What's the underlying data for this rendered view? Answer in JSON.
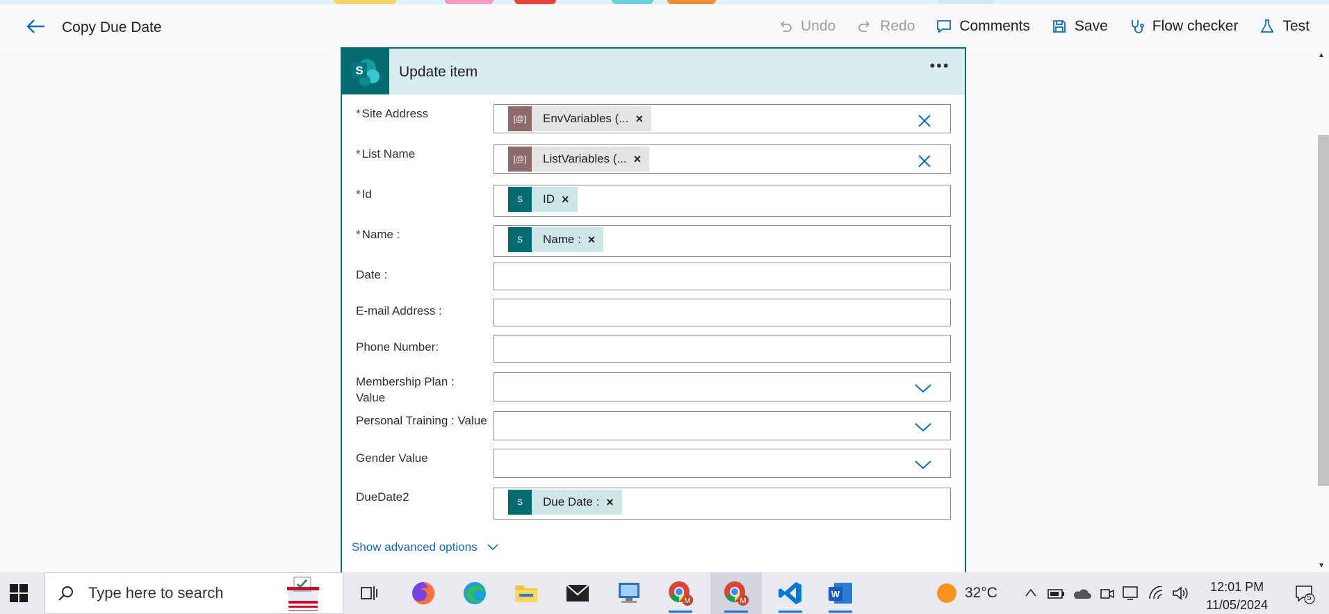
{
  "header": {
    "title": "Copy Due Date",
    "actions": {
      "undo": "Undo",
      "redo": "Redo",
      "comments": "Comments",
      "save": "Save",
      "flow_checker": "Flow checker",
      "test": "Test"
    }
  },
  "card": {
    "title": "Update item",
    "fields": {
      "site_address": {
        "label": "Site Address",
        "token": "EnvVariables (..."
      },
      "list_name": {
        "label": "List Name",
        "token": "ListVariables (..."
      },
      "id": {
        "label": "Id",
        "token": "ID"
      },
      "name": {
        "label": "Name :",
        "token": "Name :"
      },
      "date": {
        "label": "Date :"
      },
      "email": {
        "label": "E-mail Address :"
      },
      "phone": {
        "label": "Phone Number:"
      },
      "membership_line1": "Membership Plan :",
      "membership_line2": "Value",
      "personal_training": {
        "label": "Personal Training : Value"
      },
      "gender": {
        "label": "Gender Value"
      },
      "duedate2": {
        "label": "DueDate2",
        "token": "Due Date :"
      }
    },
    "required_marker": "*",
    "token_remove": "×",
    "show_advanced": "Show advanced options"
  },
  "taskbar": {
    "search_placeholder": "Type here to search",
    "temperature": "32°C",
    "time": "12:01 PM",
    "date": "11/05/2024",
    "notification_count": "5"
  },
  "colors": {
    "accent": "#0f6cbd",
    "sharepoint": "#036c70",
    "card_header": "#d9ecee",
    "variable_token": "#8e6b6b",
    "required": "#a4262c"
  }
}
